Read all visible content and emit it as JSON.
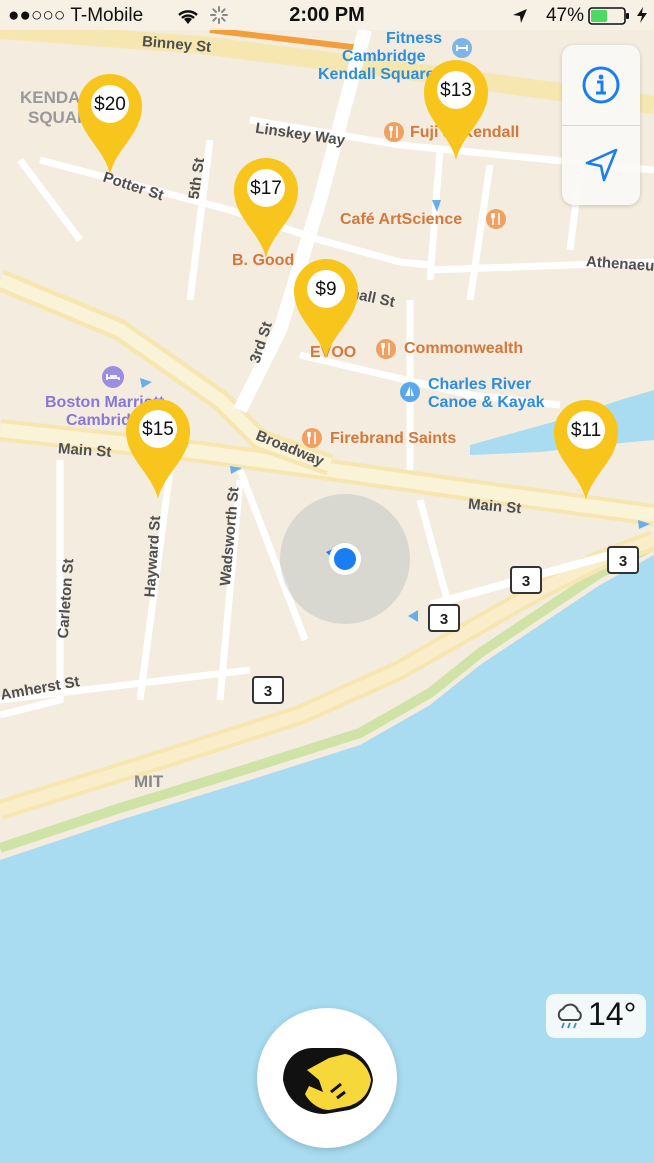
{
  "status_bar": {
    "carrier": "●●○○○ T-Mobile",
    "time": "2:00 PM",
    "battery": "47%"
  },
  "pins": [
    {
      "price": "$20"
    },
    {
      "price": "$13"
    },
    {
      "price": "$17"
    },
    {
      "price": "$9"
    },
    {
      "price": "$15"
    },
    {
      "price": "$11"
    }
  ],
  "places": {
    "fitness": "Fitness",
    "cambridge": "Cambridge",
    "kendall_square": "Kendall Square",
    "fuji": "Fuji at Kendall",
    "cafe": "Café ArtScience",
    "bgood": "B. Good",
    "evoo": "EVOO",
    "commonwealth": "Commonwealth",
    "charles1": "Charles River",
    "charles2": "Canoe & Kayak",
    "firebrand": "Firebrand Saints",
    "boston_marriott1": "Boston Marriott",
    "boston_marriott2": "Cambridge",
    "kendall_sq_label1": "KENDALL",
    "kendall_sq_label2": "SQUARE",
    "mit": "MIT"
  },
  "streets": {
    "binney": "Binney St",
    "linskey": "Linskey Way",
    "potter": "Potter St",
    "fifth": "5th St",
    "third": "3rd St",
    "athenaeum": "Athenaeum",
    "small": "Small St",
    "broadway": "Broadway",
    "main_left": "Main St",
    "main_right": "Main St",
    "carleton": "Carleton St",
    "hayward": "Hayward St",
    "wadsworth": "Wadsworth St",
    "amherst": "Amherst St"
  },
  "route_shields": [
    "3",
    "3",
    "3",
    "3"
  ],
  "weather": {
    "temperature": "14°",
    "icon": "rain-cloud-icon"
  },
  "controls": {
    "info_icon": "info-icon",
    "locate_icon": "location-arrow-icon"
  },
  "colors": {
    "pin": "#f7c51c",
    "water": "#a9dcf1",
    "land": "#f3ecdf",
    "accent": "#1a7ef0"
  }
}
